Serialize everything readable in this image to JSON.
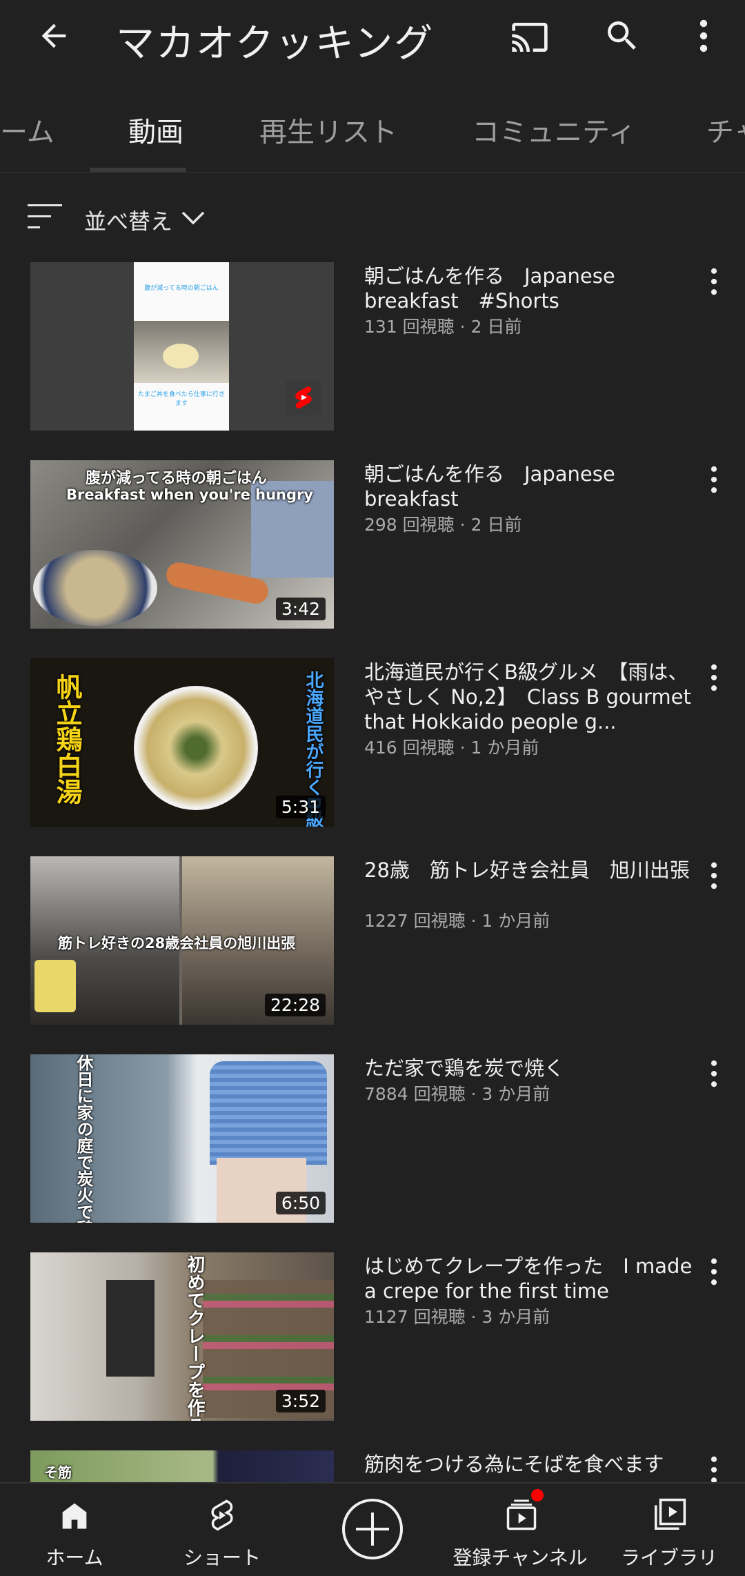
{
  "header": {
    "title": "マカオクッキング",
    "back_icon": "arrow-left-icon",
    "cast_icon": "cast-icon",
    "search_icon": "search-icon",
    "more_icon": "more-vertical-icon"
  },
  "tabs": [
    {
      "label": "ーム"
    },
    {
      "label": "動画"
    },
    {
      "label": "再生リスト"
    },
    {
      "label": "コミュニティ"
    },
    {
      "label": "チャ"
    }
  ],
  "sort": {
    "label": "並べ替え"
  },
  "videos": [
    {
      "title": "朝ごはんを作る　Japanese breakfast　#Shorts",
      "meta": "131 回視聴 · 2 日前",
      "duration": "",
      "thumb_text": "腹が減ってる時の朝ごはん",
      "thumb_text2": "たまご丼を食べたら仕事に行きます"
    },
    {
      "title": "朝ごはんを作る　Japanese breakfast",
      "meta": "298 回視聴 · 2 日前",
      "duration": "3:42",
      "thumb_text": "腹が減ってる時の朝ごはん",
      "thumb_text2": "Breakfast when you're hungry"
    },
    {
      "title": "北海道民が行くB級グルメ　【雨は、やさしく No,2】　Class B gourmet that Hokkaido people g...",
      "meta": "416 回視聴 · 1 か月前",
      "duration": "5:31",
      "thumb_text": "帆立鶏白湯",
      "thumb_text2": "北海道民が行くB級"
    },
    {
      "title": "28歳　筋トレ好き会社員　旭川出張",
      "meta": "1227 回視聴 · 1 か月前",
      "duration": "22:28",
      "thumb_text": "筋トレ好きの28歳会社員の旭川出張",
      "thumb_text2": ""
    },
    {
      "title": "ただ家で鶏を炭で焼く",
      "meta": "7884 回視聴 · 3 か月前",
      "duration": "6:50",
      "thumb_text": "休日に家の庭で炭火で鶏を焼くだけ",
      "thumb_text2": ""
    },
    {
      "title": "はじめてクレープを作った　I made a crepe for the first time",
      "meta": "1127 回視聴 · 3 か月前",
      "duration": "3:52",
      "thumb_text": "初めてクレープを作る",
      "thumb_text2": ""
    },
    {
      "title": "筋肉をつける為にそばを食べます",
      "meta": "",
      "duration": "",
      "thumb_text": "そ筋",
      "thumb_text2": ""
    }
  ],
  "bottom_nav": [
    {
      "label": "ホーム",
      "icon": "home-icon"
    },
    {
      "label": "ショート",
      "icon": "shorts-icon"
    },
    {
      "label": "",
      "icon": "create-icon"
    },
    {
      "label": "登録チャンネル",
      "icon": "subscriptions-icon"
    },
    {
      "label": "ライブラリ",
      "icon": "library-icon"
    }
  ],
  "colors": {
    "background": "#212121",
    "text": "#f1f1f1",
    "meta": "#aaaaaa",
    "shorts_red": "#ff0000",
    "notification_dot": "#ff0000"
  }
}
